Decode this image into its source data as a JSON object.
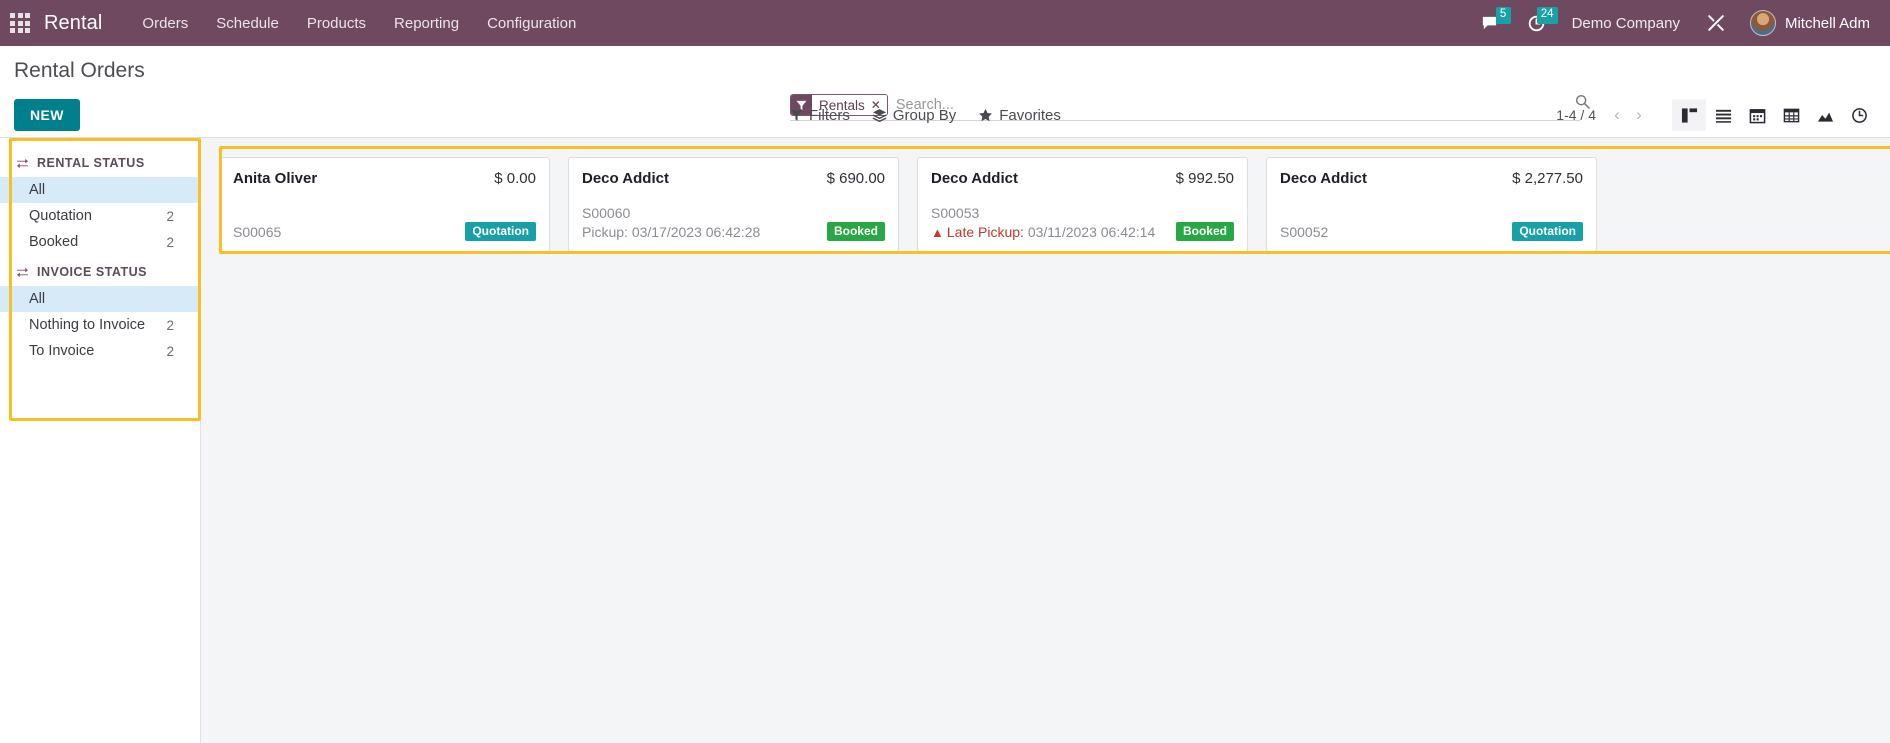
{
  "navbar": {
    "apps_icon": "grid-apps-icon",
    "brand": "Rental",
    "menu": [
      {
        "label": "Orders"
      },
      {
        "label": "Schedule"
      },
      {
        "label": "Products"
      },
      {
        "label": "Reporting"
      },
      {
        "label": "Configuration"
      }
    ],
    "messages_icon": "chat-bubble-icon",
    "messages_count": "5",
    "activities_icon": "clock-activity-icon",
    "activities_count": "24",
    "company": "Demo Company",
    "tools_icon": "wrench-tools-icon",
    "avatar_icon": "user-avatar",
    "user": "Mitchell Adm"
  },
  "control_panel": {
    "title": "Rental Orders",
    "new_button": "NEW",
    "search": {
      "facet_icon": "filter-funnel-icon",
      "facet_label": "Rentals",
      "facet_remove_icon": "close-x-icon",
      "placeholder": "Search...",
      "value": "",
      "search_icon": "search-icon"
    },
    "dropdowns": [
      {
        "label": "Filters",
        "icon": "filter-funnel-icon"
      },
      {
        "label": "Group By",
        "icon": "layers-icon"
      },
      {
        "label": "Favorites",
        "icon": "star-icon"
      }
    ],
    "pager": {
      "range": "1-4 / 4",
      "prev_icon": "chevron-left-icon",
      "next_icon": "chevron-right-icon"
    },
    "views": [
      {
        "name": "kanban",
        "icon": "kanban-view-icon",
        "active": true
      },
      {
        "name": "list",
        "icon": "list-view-icon",
        "active": false
      },
      {
        "name": "calendar",
        "icon": "calendar-view-icon",
        "active": false
      },
      {
        "name": "pivot",
        "icon": "pivot-view-icon",
        "active": false
      },
      {
        "name": "graph",
        "icon": "graph-view-icon",
        "active": false
      },
      {
        "name": "activity",
        "icon": "activity-clock-view-icon",
        "active": false
      }
    ]
  },
  "sidebar": {
    "sections": [
      {
        "title": "RENTAL STATUS",
        "icon": "exchange-arrows-icon",
        "items": [
          {
            "label": "All",
            "count": "",
            "selected": true
          },
          {
            "label": "Quotation",
            "count": "2",
            "selected": false
          },
          {
            "label": "Booked",
            "count": "2",
            "selected": false
          }
        ]
      },
      {
        "title": "INVOICE STATUS",
        "icon": "exchange-arrows-icon",
        "items": [
          {
            "label": "All",
            "count": "",
            "selected": true
          },
          {
            "label": "Nothing to Invoice",
            "count": "2",
            "selected": false
          },
          {
            "label": "To Invoice",
            "count": "2",
            "selected": false
          }
        ]
      }
    ]
  },
  "kanban": {
    "cards": [
      {
        "customer": "Anita Oliver",
        "amount": "$ 0.00",
        "reference": "S00065",
        "pickup_prefix": "",
        "pickup_date": "",
        "late": false,
        "badge": "Quotation",
        "badge_type": "quotation"
      },
      {
        "customer": "Deco Addict",
        "amount": "$ 690.00",
        "reference": "S00060",
        "pickup_prefix": "Pickup:",
        "pickup_date": "03/17/2023 06:42:28",
        "late": false,
        "badge": "Booked",
        "badge_type": "booked"
      },
      {
        "customer": "Deco Addict",
        "amount": "$ 992.50",
        "reference": "S00053",
        "pickup_prefix": "Late Pickup:",
        "pickup_date": "03/11/2023 06:42:14",
        "late": true,
        "warning_icon": "warning-triangle-icon",
        "badge": "Booked",
        "badge_type": "booked"
      },
      {
        "customer": "Deco Addict",
        "amount": "$ 2,277.50",
        "reference": "S00052",
        "pickup_prefix": "",
        "pickup_date": "",
        "late": false,
        "badge": "Quotation",
        "badge_type": "quotation"
      }
    ]
  },
  "colors": {
    "navbar_bg": "#6e4960",
    "accent_teal": "#00808c",
    "badge_quotation": "#18a0a8",
    "badge_booked": "#28a745",
    "highlight_yellow": "#f6c026",
    "selected_blue": "#d7eaf8",
    "warning_red": "#c0392b"
  }
}
